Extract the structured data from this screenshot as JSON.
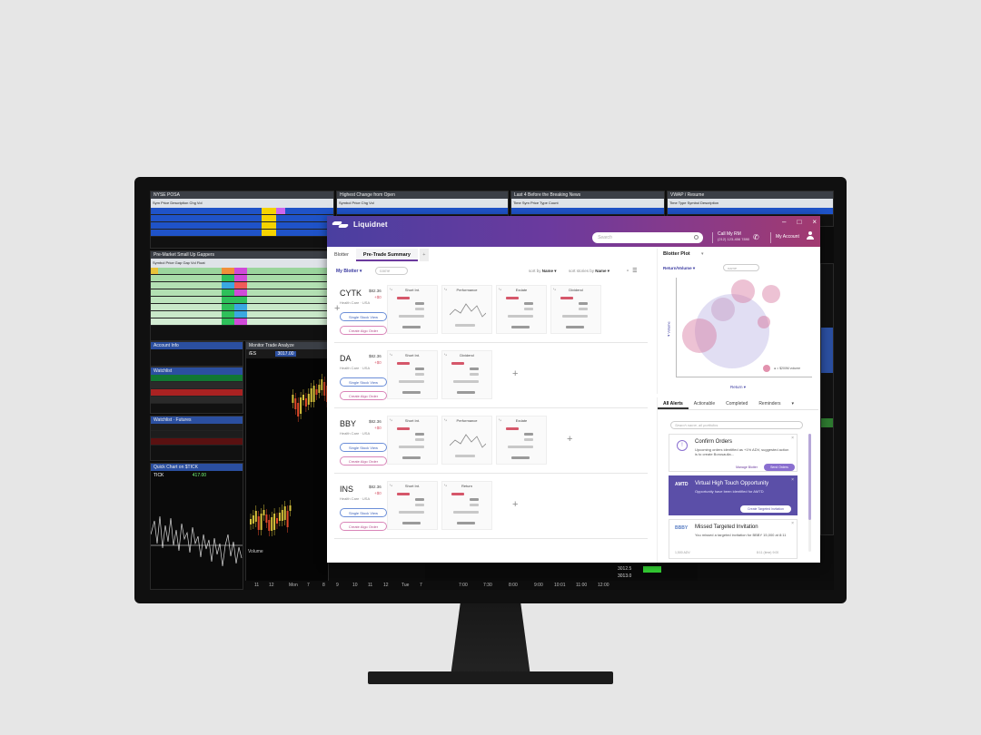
{
  "bg_panels": {
    "p1_title": "NYSE POSA",
    "p2_title": "Highest Change from Open",
    "p3_title": "Last 4 Before the Breaking News",
    "p4_title": "VWAP / Resume",
    "pm_title": "Pre-Market Small Up Gappers",
    "account_title": "Account Info",
    "watchlist_title": "Watchlist",
    "chart_title": "Quick Chart on $TICK",
    "chart_symbol": "TICK",
    "chart_price": "417.00",
    "mid_tabs": [
      "Monitor",
      "Trade",
      "Analyze",
      "Scan"
    ],
    "mid_symbol": "/ES",
    "mid_price": "3017.00",
    "volume_label": "Volume",
    "bottom_times": [
      "11",
      "12",
      "Mon",
      "7",
      "8",
      "9",
      "10",
      "11",
      "12",
      "Tue",
      "7"
    ],
    "bottom_times2": [
      "7:00",
      "7:30",
      "8:00",
      "9:00",
      "10:01",
      "11:00",
      "12:00"
    ],
    "right_prices": [
      "3012.5",
      "3013.0"
    ]
  },
  "app": {
    "name": "Liquidnet",
    "search_placeholder": "Search",
    "call_label": "Call My RM",
    "call_number": "(212) 123-456 7890",
    "account_label": "My Account",
    "win_ctrls": [
      "–",
      "□",
      "×"
    ]
  },
  "tabs": [
    "Blotter",
    "Pre-Trade Summary",
    "+"
  ],
  "blotter": {
    "title": "My Blotter ▾",
    "name_placeholder": "name",
    "sort_label": "sort by",
    "sort_value": "Name ▾",
    "sort_label2": "sort stories by",
    "sort_value2": "Name ▾",
    "btn_single": "Single Stock View",
    "btn_algo": "Create Algo Order",
    "stocks": [
      {
        "sym": "CYTK",
        "price": "$82.36",
        "chg": "+$0",
        "sector": "Health Care",
        "country": "USA",
        "cards": [
          "Short Int.",
          "Performance",
          "Exdate",
          "Dividend"
        ]
      },
      {
        "sym": "DA",
        "price": "$82.36",
        "chg": "+$0",
        "sector": "Health Care",
        "country": "USA",
        "cards": [
          "Short Int.",
          "Dividend"
        ]
      },
      {
        "sym": "BBY",
        "price": "$82.36",
        "chg": "+$0",
        "sector": "Health Care",
        "country": "USA",
        "cards": [
          "Short Int.",
          "Performance",
          "Exdate"
        ]
      },
      {
        "sym": "INS",
        "price": "$82.36",
        "chg": "+$0",
        "sector": "Health Care",
        "country": "USA",
        "cards": [
          "Short Int.",
          "Return"
        ]
      }
    ]
  },
  "plot": {
    "title": "Blotter Plot",
    "tab_menu": "▾",
    "select": "Return/Volume ▾",
    "name_placeholder": "name",
    "xlabel": "Return ▾",
    "ylabel": "▾ Volume",
    "legend": "● = $200M volume"
  },
  "alerts": {
    "tabs": [
      "All Alerts",
      "Actionable",
      "Completed",
      "Reminders"
    ],
    "tab_menu": "▾",
    "search_placeholder": "Search name, all portfolios",
    "items": [
      {
        "title": "Confirm Orders",
        "body": "Upcoming orders identified as +1% ADV, suggested action is to create Borosaulla...",
        "btn1": "Manage Blotter",
        "btn2": "Send Orders"
      },
      {
        "ticker": "AMTD",
        "title": "Virtual High Touch Opportunity",
        "body": "Opportunity have been identified for AMTD",
        "btn1": "Create Targeted Invitation"
      },
      {
        "ticker": "BBBY",
        "title": "Missed Targeted Invitation",
        "body": "You missed a targeted invitation for BBBY 15,000 at 8:11",
        "foot1": "1,500 ADV",
        "foot2": "8:11 (time) 9:00"
      }
    ]
  }
}
